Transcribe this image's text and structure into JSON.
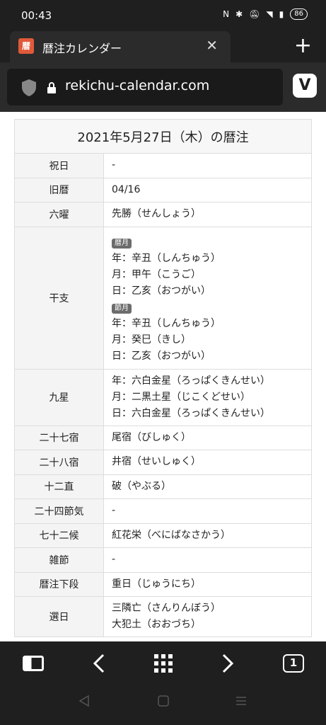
{
  "status": {
    "time": "00:43",
    "battery": "86"
  },
  "tab": {
    "favicon": "暦",
    "title": "暦注カレンダー"
  },
  "address": {
    "url": "rekichu-calendar.com"
  },
  "page": {
    "heading": "2021年5月27日（木）の暦注",
    "rows": [
      {
        "key": "祝日",
        "value": "-"
      },
      {
        "key": "旧暦",
        "value": "04/16"
      },
      {
        "key": "六曜",
        "value": "先勝（せんしょう）"
      }
    ],
    "kanshi": {
      "key": "干支",
      "badge1": "暦月",
      "lines1": [
        "年：辛丑（しんちゅう）",
        "月：甲午（こうご）",
        "日：乙亥（おつがい）"
      ],
      "badge2": "節月",
      "lines2": [
        "年：辛丑（しんちゅう）",
        "月：癸巳（きし）",
        "日：乙亥（おつがい）"
      ]
    },
    "kyusei": {
      "key": "九星",
      "lines": [
        "年：六白金星（ろっぱくきんせい）",
        "月：二黒土星（じこくどせい）",
        "日：六白金星（ろっぱくきんせい）"
      ]
    },
    "rows2": [
      {
        "key": "二十七宿",
        "value": "尾宿（びしゅく）"
      },
      {
        "key": "二十八宿",
        "value": "井宿（せいしゅく）"
      },
      {
        "key": "十二直",
        "value": "破（やぶる）"
      },
      {
        "key": "二十四節気",
        "value": "-"
      },
      {
        "key": "七十二候",
        "value": "紅花栄（べにばなさかう）"
      },
      {
        "key": "雑節",
        "value": "-"
      },
      {
        "key": "暦注下段",
        "value": "重日（じゅうにち）"
      }
    ],
    "sensu": {
      "key": "選日",
      "lines": [
        "三隣亡（さんりんぼう）",
        "大犯土（おおづち）"
      ]
    }
  },
  "bottom": {
    "tab_count": "1"
  }
}
